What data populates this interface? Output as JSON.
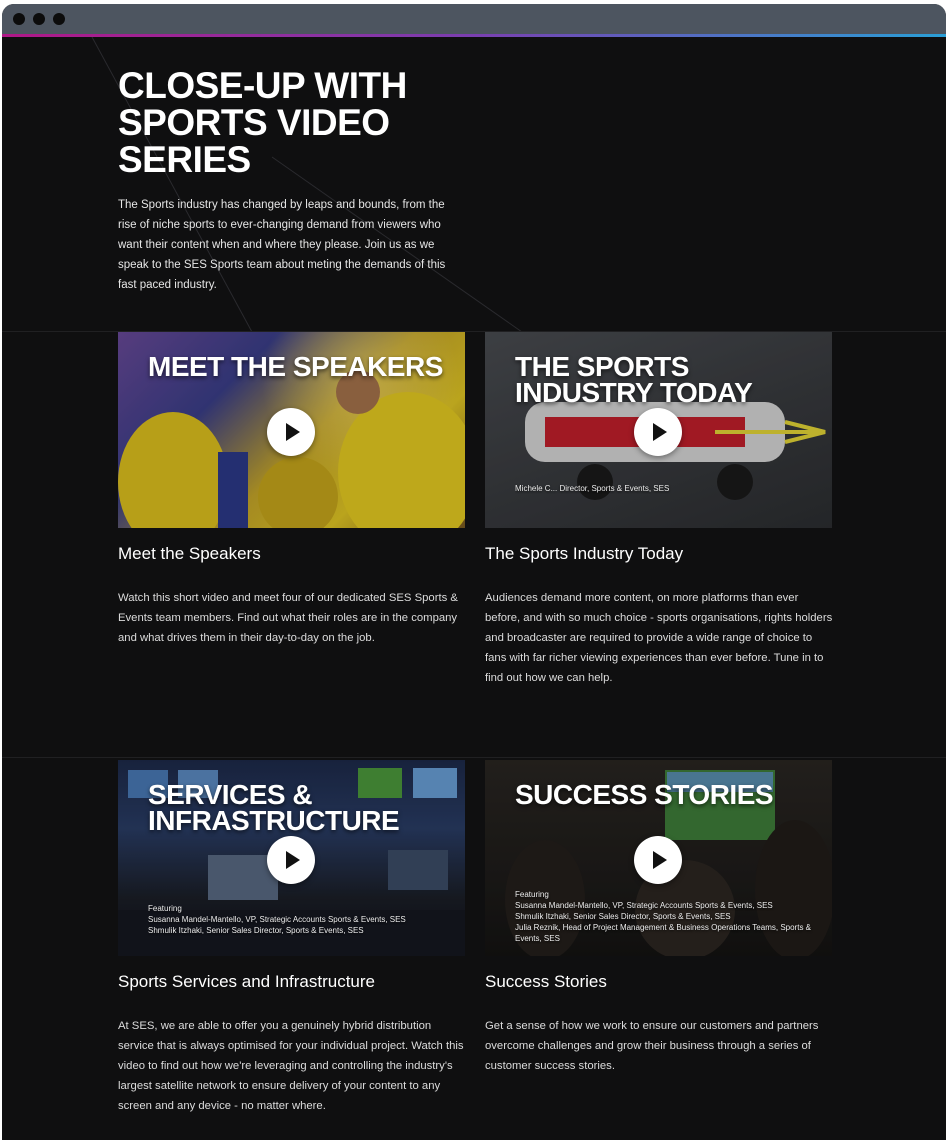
{
  "page": {
    "heading": "CLOSE-UP WITH SPORTS VIDEO SERIES",
    "intro": "The Sports industry has changed by leaps and bounds, from the rise of niche sports to ever-changing demand from viewers who want their content when and where they please. Join us as we speak to the SES Sports team about meting the demands of this fast paced industry."
  },
  "videos": [
    {
      "overlay": "MEET THE SPEAKERS",
      "title": "Meet the Speakers",
      "description": "Watch this short video and meet four of our dedicated SES Sports & Events team members. Find out what their roles are in the company and what drives them in their day-to-day on the job.",
      "featuring": []
    },
    {
      "overlay": "THE SPORTS INDUSTRY TODAY",
      "title": "The Sports Industry Today",
      "description": "Audiences demand more content, on more platforms than ever before, and with so much choice - sports organisations, rights holders and broadcaster are required to provide a wide range of choice to fans with far richer viewing experiences than ever before. Tune in to find out how we can help.",
      "featuring": [
        "Michele C... Director, Sports & Events, SES"
      ]
    },
    {
      "overlay": "SERVICES & INFRASTRUCTURE",
      "title": "Sports Services and Infrastructure",
      "description": "At SES, we are able to offer you a genuinely hybrid distribution service that is always optimised for your individual project. Watch this video to find out how we're leveraging and controlling the industry's largest satellite network to ensure delivery of your content to any screen and any device - no matter where.",
      "featuring_label": "Featuring",
      "featuring": [
        "Susanna Mandel-Mantello, VP, Strategic Accounts Sports & Events, SES",
        "Shmulik Itzhaki, Senior Sales Director, Sports & Events, SES"
      ]
    },
    {
      "overlay": "SUCCESS STORIES",
      "title": "Success Stories",
      "description": "Get a sense of how we work to ensure our customers and partners overcome challenges and grow their business through a series of customer success stories.",
      "featuring_label": "Featuring",
      "featuring": [
        "Susanna Mandel-Mantello, VP, Strategic Accounts Sports & Events, SES",
        "Shmulik Itzhaki, Senior Sales Director, Sports & Events, SES",
        "Julia Reznik, Head of Project Management & Business Operations Teams, Sports & Events, SES"
      ]
    }
  ]
}
